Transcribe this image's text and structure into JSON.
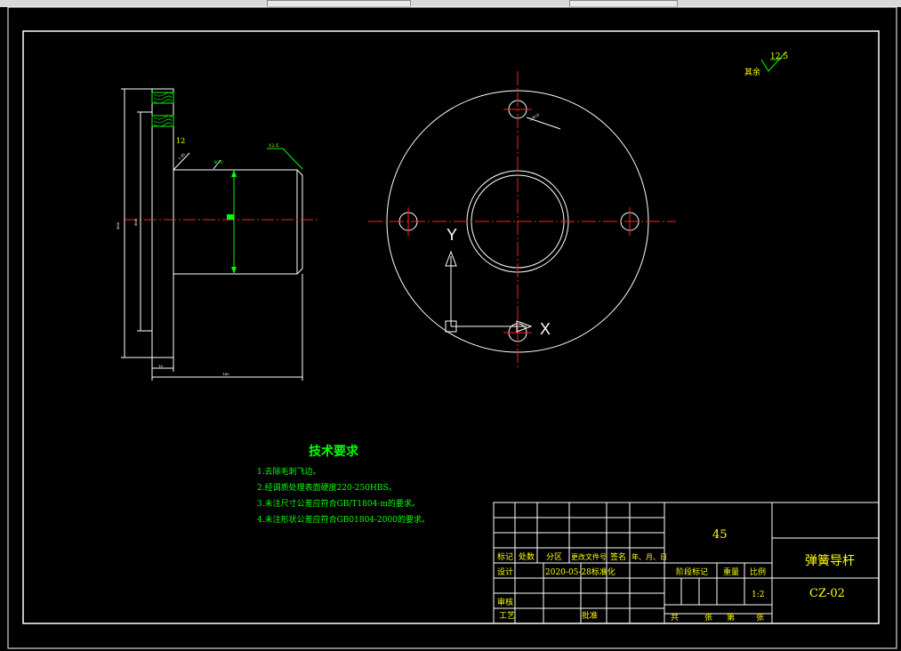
{
  "tech_requirements": {
    "title": "技术要求",
    "items": [
      "1.去除毛刺飞边。",
      "2.经调质处理表面硬度220-250HBS。",
      "3.未注尺寸公差应符合GB/T1804-m的要求。",
      "4.未注形状公差应符合GB01804-2000的要求。"
    ]
  },
  "roughness": {
    "label": "其余",
    "value": "12.5"
  },
  "side_view": {
    "roughness_note": "12.5",
    "left_rough": "12",
    "dims": [
      "Ф20",
      "Ф80",
      "Ф60",
      "1:45",
      "10",
      "140"
    ]
  },
  "front_view": {
    "hole_note": "3-Ф10",
    "axis_x": "X",
    "axis_y": "Y"
  },
  "title_block": {
    "material": "45",
    "part_name": "弹簧导杆",
    "drawing_no": "CZ-02",
    "scale": "1:2",
    "header_row": [
      "标记",
      "处数",
      "分区",
      "更改文件号",
      "签名",
      "年、月、日"
    ],
    "design_label": "设计",
    "standardize": "2020-05-28标准化",
    "review_label": "审核",
    "process_label": "工艺",
    "approve_label": "批准",
    "stage_label": "阶段标记",
    "weight_label": "重量",
    "ratio_label": "比例",
    "sheets_total": "共",
    "sheets_unit": "张",
    "sheet_no": "第",
    "sheet_unit": "张"
  }
}
